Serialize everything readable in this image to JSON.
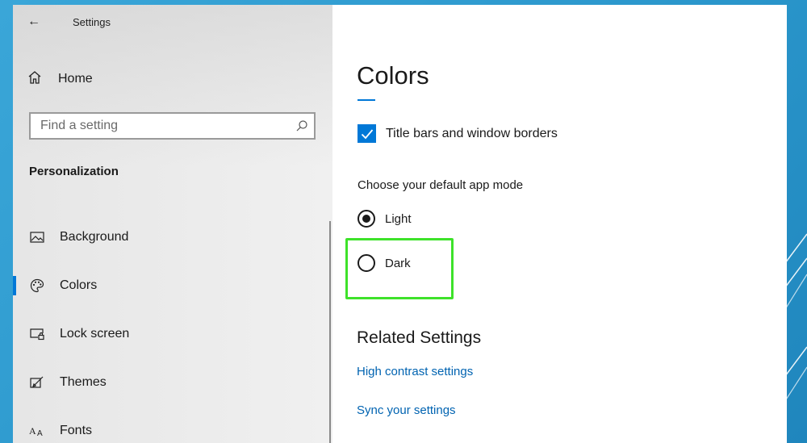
{
  "window": {
    "app_title": "Settings"
  },
  "sidebar": {
    "home_label": "Home",
    "search": {
      "placeholder": "Find a setting"
    },
    "section_title": "Personalization",
    "items": [
      {
        "label": "Background",
        "icon": "background-icon",
        "active": false
      },
      {
        "label": "Colors",
        "icon": "palette-icon",
        "active": true
      },
      {
        "label": "Lock screen",
        "icon": "lock-screen-icon",
        "active": false
      },
      {
        "label": "Themes",
        "icon": "themes-icon",
        "active": false
      },
      {
        "label": "Fonts",
        "icon": "fonts-icon",
        "active": false
      }
    ]
  },
  "main": {
    "title": "Colors",
    "title_bars_checkbox": {
      "label": "Title bars and window borders",
      "checked": true
    },
    "app_mode": {
      "heading": "Choose your default app mode",
      "options": [
        {
          "label": "Light",
          "selected": true
        },
        {
          "label": "Dark",
          "selected": false
        }
      ]
    },
    "related": {
      "heading": "Related Settings",
      "links": [
        "High contrast settings",
        "Sync your settings"
      ]
    }
  },
  "colors": {
    "accent": "#0078d7",
    "link": "#0063b1",
    "highlight": "#3ee22a",
    "backdrop": "#2e9ed2"
  }
}
